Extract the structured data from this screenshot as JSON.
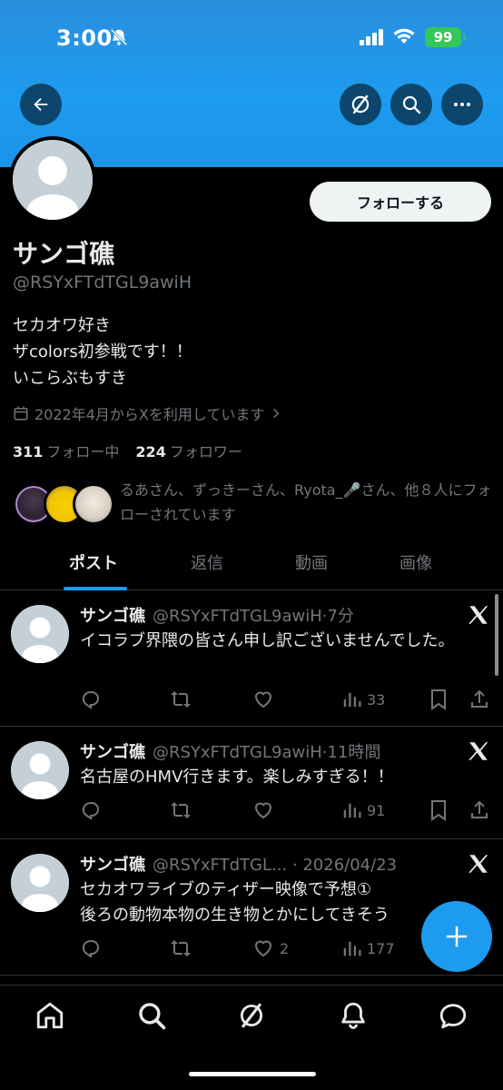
{
  "status_bar": {
    "time": "3:00",
    "battery": "99"
  },
  "profile": {
    "display_name": "サンゴ礁",
    "handle": "@RSYxFTdTGL9awiH",
    "bio_lines": [
      "セカオワ好き",
      "ザcolors初参戦です！！",
      "いこらぶもすき"
    ],
    "joined": "2022年4月からXを利用しています",
    "following_count": "311",
    "following_label": "フォロー中",
    "followers_count": "224",
    "followers_label": "フォロワー",
    "follow_button_label": "フォローする",
    "known_followers_text": "るあさん、ずっきーさん、Ryota_🎤さん、他８人にフォローされています"
  },
  "tabs": [
    {
      "label": "ポスト",
      "active": true
    },
    {
      "label": "返信",
      "active": false
    },
    {
      "label": "動画",
      "active": false
    },
    {
      "label": "画像",
      "active": false
    }
  ],
  "posts": [
    {
      "name": "サンゴ礁",
      "handle": "@RSYxFTdTGL9awiH",
      "time": "·7分",
      "text": "イコラブ界隈の皆さん申し訳ございませんでした。",
      "likes": "",
      "views": "33"
    },
    {
      "name": "サンゴ礁",
      "handle": "@RSYxFTdTGL9awiH",
      "time": "·11時間",
      "text": "名古屋のHMV行きます。楽しみすぎる！！",
      "likes": "",
      "views": "91"
    },
    {
      "name": "サンゴ礁",
      "handle": "@RSYxFTdTGL...",
      "time": " · 2026/04/23",
      "text_line1": "セカオワライブのティザー映像で予想①",
      "text_line2": "後ろの動物本物の生き物とかにしてきそう",
      "likes": "2",
      "views": "177"
    }
  ],
  "colors": {
    "accent": "#1d9bf0",
    "banner": "#1d9bf0",
    "background": "#000000",
    "muted": "#71767b"
  },
  "icons": [
    "back-arrow-icon",
    "grok-icon",
    "search-icon",
    "more-icon",
    "calendar-icon",
    "chevron-right-icon",
    "x-logo-icon",
    "reply-icon",
    "repost-icon",
    "like-icon",
    "views-icon",
    "bookmark-icon",
    "share-icon",
    "plus-icon",
    "home-icon",
    "notifications-icon",
    "messages-icon"
  ]
}
